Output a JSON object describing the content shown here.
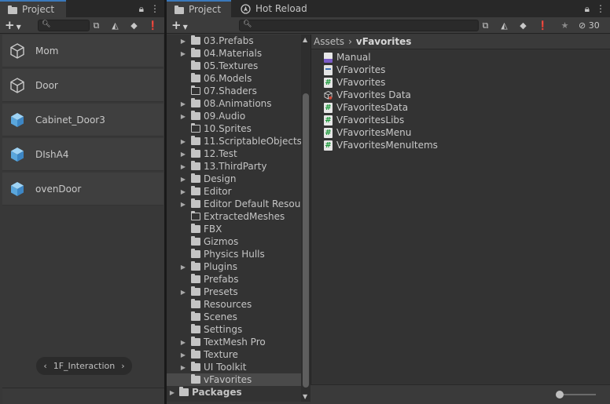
{
  "left_panel": {
    "tab_label": "Project",
    "add_button": "+",
    "search_placeholder": "",
    "items": [
      {
        "label": "Mom",
        "icon": "cube-outline-icon"
      },
      {
        "label": "Door",
        "icon": "cube-outline-icon"
      },
      {
        "label": "Cabinet_Door3",
        "icon": "prefab-cube-icon"
      },
      {
        "label": "DIshA4",
        "icon": "prefab-cube-icon"
      },
      {
        "label": "ovenDoor",
        "icon": "prefab-cube-icon"
      }
    ],
    "breadcrumb": {
      "prev": "‹",
      "label": "1F_Interaction",
      "next": "›"
    }
  },
  "right_panel": {
    "tabs": [
      {
        "label": "Project",
        "active": true
      },
      {
        "label": "Hot Reload",
        "active": false
      }
    ],
    "add_button": "+",
    "hidden_count": "30",
    "tree": [
      {
        "label": "03.Prefabs",
        "expandable": true,
        "empty": false
      },
      {
        "label": "04.Materials",
        "expandable": true,
        "empty": false
      },
      {
        "label": "05.Textures",
        "expandable": false,
        "empty": false
      },
      {
        "label": "06.Models",
        "expandable": false,
        "empty": false
      },
      {
        "label": "07.Shaders",
        "expandable": false,
        "empty": true
      },
      {
        "label": "08.Animations",
        "expandable": true,
        "empty": false
      },
      {
        "label": "09.Audio",
        "expandable": true,
        "empty": false
      },
      {
        "label": "10.Sprites",
        "expandable": false,
        "empty": true
      },
      {
        "label": "11.ScriptableObjects",
        "expandable": true,
        "empty": false
      },
      {
        "label": "12.Test",
        "expandable": true,
        "empty": false
      },
      {
        "label": "13.ThirdParty",
        "expandable": true,
        "empty": false
      },
      {
        "label": "Design",
        "expandable": true,
        "empty": false
      },
      {
        "label": "Editor",
        "expandable": true,
        "empty": false
      },
      {
        "label": "Editor Default Resources",
        "expandable": true,
        "empty": false
      },
      {
        "label": "ExtractedMeshes",
        "expandable": false,
        "empty": true
      },
      {
        "label": "FBX",
        "expandable": false,
        "empty": false
      },
      {
        "label": "Gizmos",
        "expandable": false,
        "empty": false
      },
      {
        "label": "Physics Hulls",
        "expandable": false,
        "empty": false
      },
      {
        "label": "Plugins",
        "expandable": true,
        "empty": false
      },
      {
        "label": "Prefabs",
        "expandable": false,
        "empty": false
      },
      {
        "label": "Presets",
        "expandable": true,
        "empty": false
      },
      {
        "label": "Resources",
        "expandable": false,
        "empty": false
      },
      {
        "label": "Scenes",
        "expandable": false,
        "empty": false
      },
      {
        "label": "Settings",
        "expandable": false,
        "empty": false
      },
      {
        "label": "TextMesh Pro",
        "expandable": true,
        "empty": false
      },
      {
        "label": "Texture",
        "expandable": true,
        "empty": false
      },
      {
        "label": "UI Toolkit",
        "expandable": true,
        "empty": false
      },
      {
        "label": "vFavorites",
        "expandable": false,
        "empty": false,
        "selected": true
      }
    ],
    "tree_root": {
      "label": "Packages",
      "expandable": true
    },
    "breadcrumb": {
      "root": "Assets",
      "sep": "›",
      "current": "vFavorites"
    },
    "files": [
      {
        "label": "Manual",
        "icon": "manual-file-icon"
      },
      {
        "label": "VFavorites",
        "icon": "asmdef-file-icon"
      },
      {
        "label": "VFavorites",
        "icon": "csharp-script-icon"
      },
      {
        "label": "VFavorites Data",
        "icon": "scriptable-object-icon"
      },
      {
        "label": "VFavoritesData",
        "icon": "csharp-script-icon"
      },
      {
        "label": "VFavoritesLibs",
        "icon": "csharp-script-icon"
      },
      {
        "label": "VFavoritesMenu",
        "icon": "csharp-script-icon"
      },
      {
        "label": "VFavoritesMenuItems",
        "icon": "csharp-script-icon"
      }
    ]
  },
  "colors": {
    "accent": "#3a79bb",
    "panel_bg": "#383838",
    "tree_bg": "#333333",
    "script_green": "#1a9a38"
  }
}
